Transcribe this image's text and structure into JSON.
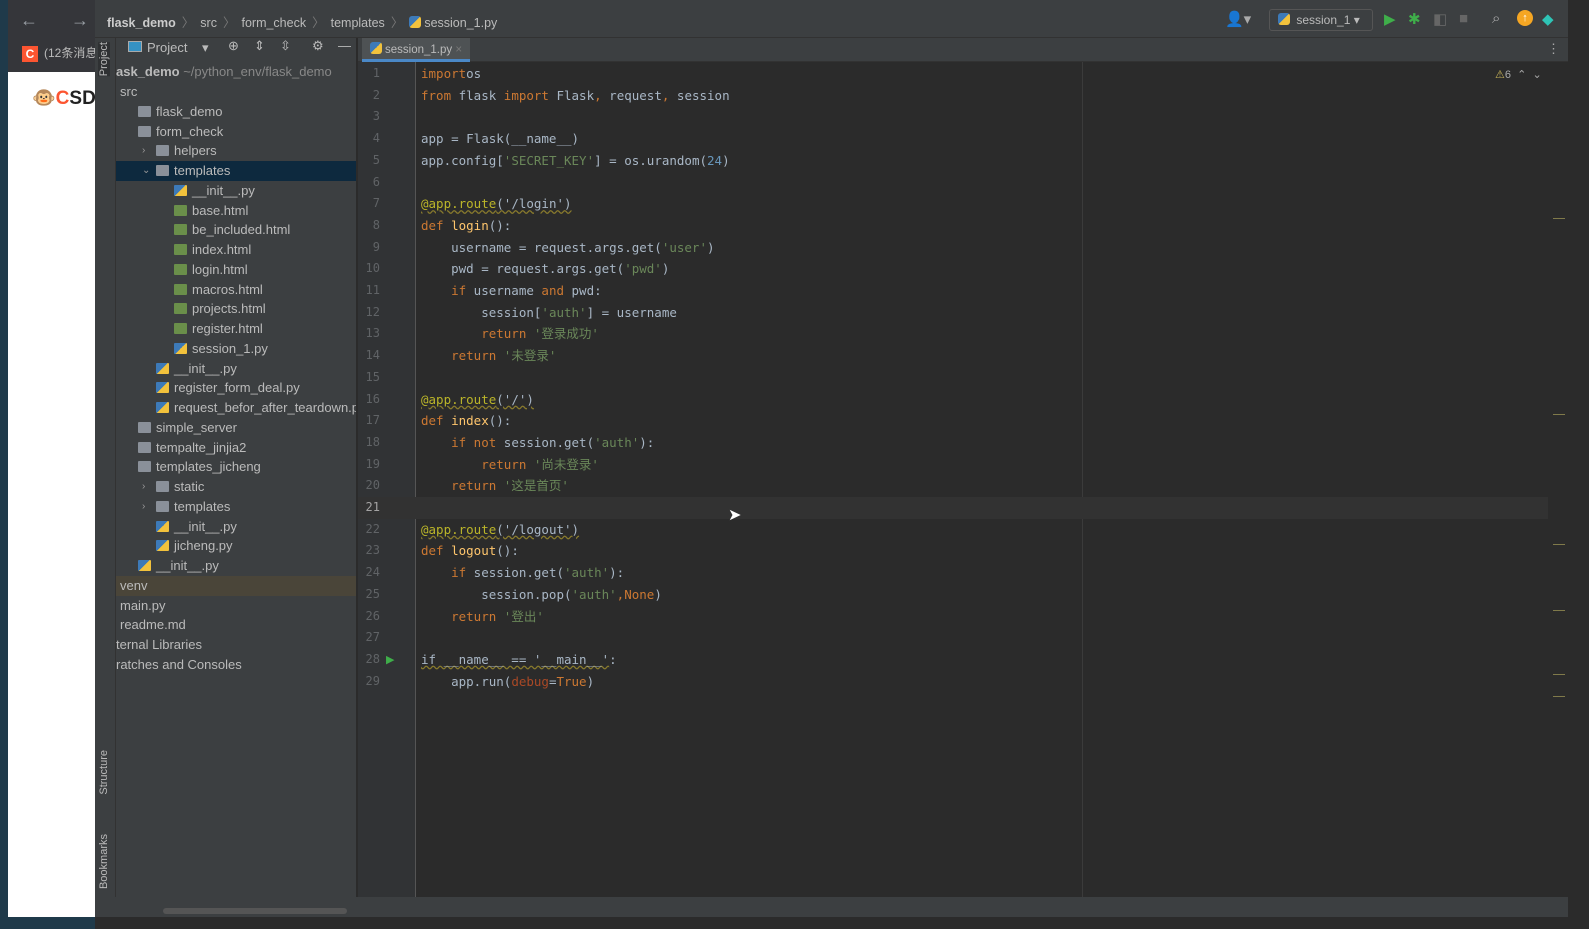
{
  "browser": {
    "nav": "← → ↻",
    "tab_label": "(12条消息",
    "tab_icon": "C",
    "logo": "CSDN"
  },
  "breadcrumb": [
    "flask_demo",
    "src",
    "form_check",
    "templates",
    "session_1.py"
  ],
  "toolbar": {
    "run_config": "session_1",
    "warnings": "6"
  },
  "strip": {
    "project": "Project",
    "structure": "Structure",
    "bookmarks": "Bookmarks"
  },
  "project_panel": {
    "title": "Project",
    "root": "ask_demo",
    "root_path": "~/python_env/flask_demo",
    "items": [
      {
        "label": "src",
        "depth": 0,
        "icon": "none"
      },
      {
        "label": "flask_demo",
        "depth": 1,
        "icon": "folder"
      },
      {
        "label": "form_check",
        "depth": 1,
        "icon": "folder"
      },
      {
        "label": "helpers",
        "depth": 2,
        "icon": "folder",
        "arrow": "›"
      },
      {
        "label": "templates",
        "depth": 2,
        "icon": "folder",
        "arrow": "⌄",
        "state": "sel"
      },
      {
        "label": "__init__.py",
        "depth": 3,
        "icon": "py"
      },
      {
        "label": "base.html",
        "depth": 3,
        "icon": "html"
      },
      {
        "label": "be_included.html",
        "depth": 3,
        "icon": "html"
      },
      {
        "label": "index.html",
        "depth": 3,
        "icon": "html"
      },
      {
        "label": "login.html",
        "depth": 3,
        "icon": "html"
      },
      {
        "label": "macros.html",
        "depth": 3,
        "icon": "html"
      },
      {
        "label": "projects.html",
        "depth": 3,
        "icon": "html"
      },
      {
        "label": "register.html",
        "depth": 3,
        "icon": "html"
      },
      {
        "label": "session_1.py",
        "depth": 3,
        "icon": "py"
      },
      {
        "label": "__init__.py",
        "depth": 2,
        "icon": "py"
      },
      {
        "label": "register_form_deal.py",
        "depth": 2,
        "icon": "py"
      },
      {
        "label": "request_befor_after_teardown.py",
        "depth": 2,
        "icon": "py"
      },
      {
        "label": "simple_server",
        "depth": 1,
        "icon": "folder"
      },
      {
        "label": "tempalte_jinjia2",
        "depth": 1,
        "icon": "folder"
      },
      {
        "label": "templates_jicheng",
        "depth": 1,
        "icon": "folder"
      },
      {
        "label": "static",
        "depth": 2,
        "icon": "folder",
        "arrow": "›"
      },
      {
        "label": "templates",
        "depth": 2,
        "icon": "folder",
        "arrow": "›"
      },
      {
        "label": "__init__.py",
        "depth": 2,
        "icon": "py"
      },
      {
        "label": "jicheng.py",
        "depth": 2,
        "icon": "py"
      },
      {
        "label": "__init__.py",
        "depth": 1,
        "icon": "py"
      },
      {
        "label": "venv",
        "depth": 0,
        "icon": "none",
        "state": "hl"
      },
      {
        "label": "main.py",
        "depth": 0,
        "icon": "none"
      },
      {
        "label": "readme.md",
        "depth": 0,
        "icon": "none"
      },
      {
        "label": "ternal Libraries",
        "depth": -1,
        "icon": "none"
      },
      {
        "label": "ratches and Consoles",
        "depth": -1,
        "icon": "none"
      }
    ]
  },
  "editor": {
    "tab": "session_1.py",
    "current_line": 21,
    "lines": [
      [
        [
          "k",
          "import"
        ],
        [
          "",
          "os"
        ]
      ],
      [
        [
          "k",
          "from"
        ],
        [
          "",
          " flask "
        ],
        [
          "k",
          "import"
        ],
        [
          "",
          " Flask"
        ],
        [
          "k",
          ","
        ],
        [
          "",
          " request"
        ],
        [
          "k",
          ","
        ],
        [
          "",
          " session"
        ]
      ],
      [],
      [
        [
          "",
          "app = Flask(__name__)"
        ]
      ],
      [
        [
          "",
          "app.config["
        ],
        [
          "s",
          "'SECRET_KEY'"
        ],
        [
          "",
          "] = os.urandom("
        ],
        [
          "n",
          "24"
        ],
        [
          "",
          ")"
        ]
      ],
      [],
      [
        [
          "d",
          "@app.route"
        ],
        [
          "w",
          "('/login')"
        ]
      ],
      [
        [
          "k",
          "def "
        ],
        [
          "f",
          "login"
        ],
        [
          "",
          "():"
        ]
      ],
      [
        [
          "",
          "    username = request.args.get("
        ],
        [
          "s",
          "'user'"
        ],
        [
          "",
          ")"
        ]
      ],
      [
        [
          "",
          "    pwd = request.args.get("
        ],
        [
          "s",
          "'pwd'"
        ],
        [
          "",
          ")"
        ]
      ],
      [
        [
          "k",
          "    if"
        ],
        [
          "",
          " username "
        ],
        [
          "k",
          "and"
        ],
        [
          "",
          " pwd:"
        ]
      ],
      [
        [
          "",
          "        session["
        ],
        [
          "s",
          "'auth'"
        ],
        [
          "",
          "] = username"
        ]
      ],
      [
        [
          "k",
          "        return "
        ],
        [
          "s",
          "'登录成功'"
        ]
      ],
      [
        [
          "k",
          "    return "
        ],
        [
          "s",
          "'未登录'"
        ]
      ],
      [],
      [
        [
          "d",
          "@app.route"
        ],
        [
          "w",
          "('/')"
        ]
      ],
      [
        [
          "k",
          "def "
        ],
        [
          "f",
          "index"
        ],
        [
          "",
          "():"
        ]
      ],
      [
        [
          "k",
          "    if not"
        ],
        [
          "",
          " session.get("
        ],
        [
          "s",
          "'auth'"
        ],
        [
          "",
          "):"
        ]
      ],
      [
        [
          "k",
          "        return "
        ],
        [
          "s",
          "'尚未登录'"
        ]
      ],
      [
        [
          "k",
          "    return "
        ],
        [
          "s",
          "'这是首页'"
        ]
      ],
      [],
      [
        [
          "d",
          "@app.route"
        ],
        [
          "w",
          "('/logout')"
        ]
      ],
      [
        [
          "k",
          "def "
        ],
        [
          "f",
          "logout"
        ],
        [
          "",
          "():"
        ]
      ],
      [
        [
          "k",
          "    if"
        ],
        [
          "",
          " session.get("
        ],
        [
          "s",
          "'auth'"
        ],
        [
          "",
          "):"
        ]
      ],
      [
        [
          "",
          "        session.pop("
        ],
        [
          "s",
          "'auth'"
        ],
        [
          "k",
          ","
        ],
        [
          "k",
          "None"
        ],
        [
          "",
          ")"
        ]
      ],
      [
        [
          "k",
          "    return "
        ],
        [
          "s",
          "'登出'"
        ]
      ],
      [],
      [
        [
          "w",
          "if __name__ == '__main__'"
        ],
        [
          "",
          ":"
        ]
      ],
      [
        [
          "",
          "    app.run("
        ],
        [
          "p",
          "debug"
        ],
        [
          "",
          "="
        ],
        [
          "k",
          "True"
        ],
        [
          "",
          ")"
        ]
      ]
    ]
  }
}
